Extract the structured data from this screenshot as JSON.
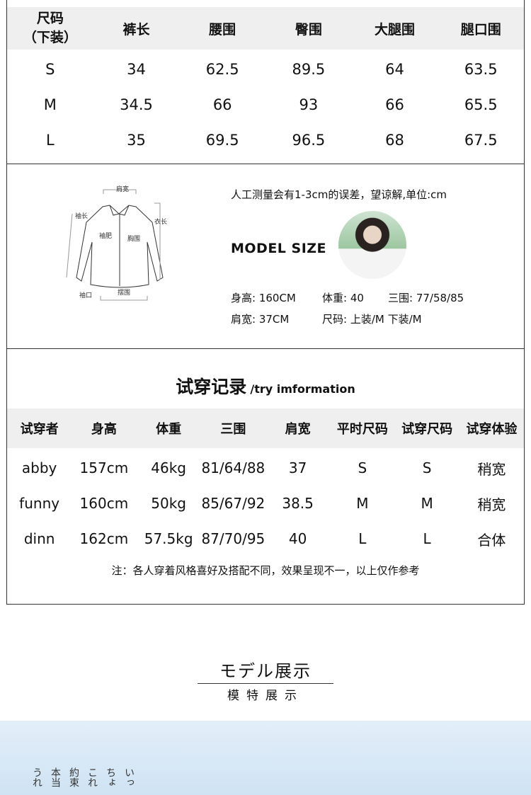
{
  "size_table": {
    "headers": [
      "尺码\n（下装）",
      "裤长",
      "腰围",
      "臀围",
      "大腿围",
      "腿口围"
    ],
    "rows": [
      [
        "S",
        "34",
        "62.5",
        "89.5",
        "64",
        "63.5"
      ],
      [
        "M",
        "34.5",
        "66",
        "93",
        "66",
        "65.5"
      ],
      [
        "L",
        "35",
        "69.5",
        "96.5",
        "68",
        "67.5"
      ]
    ]
  },
  "diagram": {
    "labels": {
      "shoulder": "肩宽",
      "sleeve": "袖长",
      "length": "衣长",
      "sleeve_width": "袖肥",
      "chest": "胸围",
      "hem": "摆围",
      "cuff": "袖口"
    }
  },
  "model": {
    "note": "人工测量会有1-3cm的误差，望谅解,单位:cm",
    "title": "MODEL SIZE",
    "height": "身高: 160CM",
    "weight": "体重: 40",
    "measurements": "三围: 77/58/85",
    "shoulder": "肩宽: 37CM",
    "size": "尺码: 上装/M 下装/M"
  },
  "try_on": {
    "title": "试穿记录",
    "subtitle": "/try imformation",
    "headers": [
      "试穿者",
      "身高",
      "体重",
      "三围",
      "肩宽",
      "平时尺码",
      "试穿尺码",
      "试穿体验"
    ],
    "rows": [
      [
        "abby",
        "157cm",
        "46kg",
        "81/64/88",
        "37",
        "S",
        "S",
        "稍宽"
      ],
      [
        "funny",
        "160cm",
        "50kg",
        "85/67/92",
        "38.5",
        "M",
        "M",
        "稍宽"
      ],
      [
        "dinn",
        "162cm",
        "57.5kg",
        "87/70/95",
        "40",
        "L",
        "L",
        "合体"
      ]
    ],
    "note": "注：各人穿着风格喜好及搭配不同，效果呈现不一，以上仅作参考"
  },
  "model_show": {
    "title": "モデル展示",
    "subtitle": "模特展示"
  },
  "hero_text": [
    "いっ",
    "ちょ",
    "これ",
    "約束",
    "本当",
    "うれ"
  ]
}
